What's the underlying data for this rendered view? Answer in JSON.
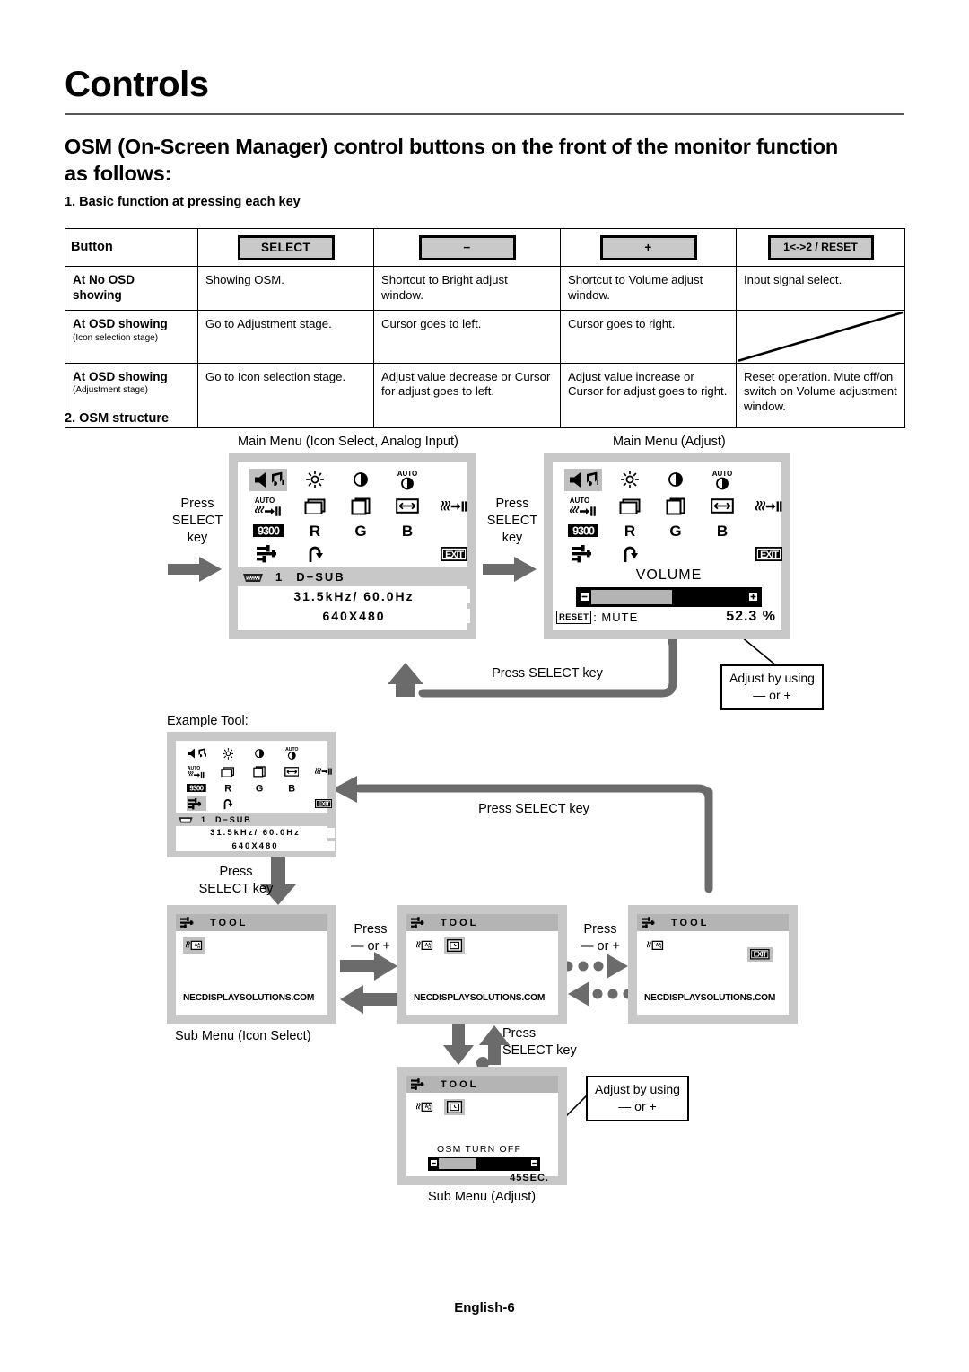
{
  "document": {
    "title": "Controls",
    "section_heading": "OSM (On-Screen Manager) control buttons on the front of the monitor function as follows:",
    "footer": "English-6"
  },
  "section1": {
    "heading": "1. Basic function at pressing each key",
    "table": {
      "row_header_label": "Button",
      "buttons": [
        {
          "label": "SELECT"
        },
        {
          "label": "−"
        },
        {
          "label": "+"
        },
        {
          "label": "1<->2 / RESET"
        }
      ],
      "rows": [
        {
          "label": "At No OSD",
          "label2": "showing",
          "sub": "",
          "cells": [
            "Showing OSM.",
            "Shortcut to Bright adjust window.",
            "Shortcut to Volume adjust window.",
            "Input signal select."
          ]
        },
        {
          "label": "At OSD showing",
          "label2": "",
          "sub": "(Icon selection stage)",
          "cells": [
            "Go to Adjustment stage.",
            "Cursor goes to left.",
            "Cursor goes to right.",
            ""
          ]
        },
        {
          "label": "At OSD showing",
          "label2": "",
          "sub": "(Adjustment stage)",
          "cells": [
            "Go to Icon selection stage.",
            "Adjust value decrease or Cursor for adjust goes to left.",
            "Adjust value increase or Cursor for adjust goes to right.",
            "Reset operation. Mute off/on switch on Volume adjustment window."
          ]
        }
      ]
    }
  },
  "section2": {
    "heading": "2. OSM structure",
    "captions": {
      "main_menu_icon_select": "Main Menu (Icon Select, Analog Input)",
      "main_menu_adjust": "Main Menu (Adjust)",
      "example_tool": "Example Tool:",
      "sub_menu_icon_select": "Sub Menu (Icon Select)",
      "sub_menu_adjust": "Sub Menu (Adjust)"
    },
    "flow_labels": {
      "press_select_key_1": "Press\nSELECT\nkey",
      "press_select_key_2": "Press\nSELECT\nkey",
      "press_select_key_back": "Press  SELECT  key",
      "press_select_key_tool": "Press  SELECT  key",
      "press_select_down": "Press\nSELECT  key",
      "press_select_updown": "Press\nSELECT  key",
      "press_minus_or_plus_1": "Press\n— or  +",
      "press_minus_or_plus_2": "Press\n— or  +"
    },
    "notes": {
      "adjust_note_volume": "Adjust by using\n— or  +",
      "adjust_note_osm": "Adjust by using\n— or  +"
    },
    "osd_icons": [
      {
        "name": "volume-icon",
        "glyph": "volume"
      },
      {
        "name": "brightness-icon",
        "glyph": "brightness"
      },
      {
        "name": "contrast-icon",
        "glyph": "contrast"
      },
      {
        "name": "auto-contrast-icon",
        "glyph": "auto-contrast"
      },
      {
        "name": "blank-icon",
        "glyph": "blank"
      },
      {
        "name": "auto-adjust-icon",
        "glyph": "auto-adjust"
      },
      {
        "name": "h-position-icon",
        "glyph": "h-position"
      },
      {
        "name": "v-position-icon",
        "glyph": "v-position"
      },
      {
        "name": "h-size-icon",
        "glyph": "h-size"
      },
      {
        "name": "fine-icon",
        "glyph": "fine"
      },
      {
        "name": "color-temp-9300-icon",
        "glyph": "9300"
      },
      {
        "name": "red-icon",
        "glyph": "R"
      },
      {
        "name": "green-icon",
        "glyph": "G"
      },
      {
        "name": "blue-icon",
        "glyph": "B"
      },
      {
        "name": "blank-icon",
        "glyph": "blank"
      },
      {
        "name": "tool-icon",
        "glyph": "tool"
      },
      {
        "name": "factory-reset-icon",
        "glyph": "reset"
      },
      {
        "name": "blank-icon",
        "glyph": "blank"
      },
      {
        "name": "blank-icon",
        "glyph": "blank"
      },
      {
        "name": "exit-icon",
        "glyph": "EXIT"
      }
    ],
    "main_menu": {
      "input_number": "1",
      "input_name": "D−SUB",
      "freq_line": "31.5kHz/  60.0Hz",
      "resolution_line": "640X480",
      "selected_icon": "volume-icon"
    },
    "adjust_menu": {
      "title": "VOLUME",
      "reset_badge": "RESET",
      "reset_label": ": MUTE",
      "value": "52.3 %",
      "percent": 52.3,
      "selected_icon": "volume-icon"
    },
    "example_menu": {
      "input_number": "1",
      "input_name": "D−SUB",
      "freq_line": "31.5kHz/  60.0Hz",
      "resolution_line": "640X480",
      "selected_icon": "tool-icon"
    },
    "tool_submenus": {
      "title": "TOOL",
      "url": "NECDISPLAYSOLUTIONS.COM",
      "icons": [
        {
          "name": "language-icon",
          "glyph": "language"
        },
        {
          "name": "osm-timer-icon",
          "glyph": "timer"
        },
        {
          "name": "exit-icon",
          "glyph": "EXIT"
        }
      ],
      "panel1_selected": "language-icon",
      "panel2_selected": "osm-timer-icon",
      "panel3_selected": "exit-icon",
      "adjust_panel": {
        "selected": "osm-timer-icon",
        "label": "OSM TURN OFF",
        "value": "45SEC.",
        "percent": 42
      }
    }
  },
  "colors": {
    "osd_bezel": "#c8c8c8",
    "osd_screen": "#ffffff",
    "highlight": "#c0c0c0",
    "arrow": "#6b6b6b",
    "toolbar": "#b4b4b4",
    "keycap": "#c9c9c9"
  }
}
